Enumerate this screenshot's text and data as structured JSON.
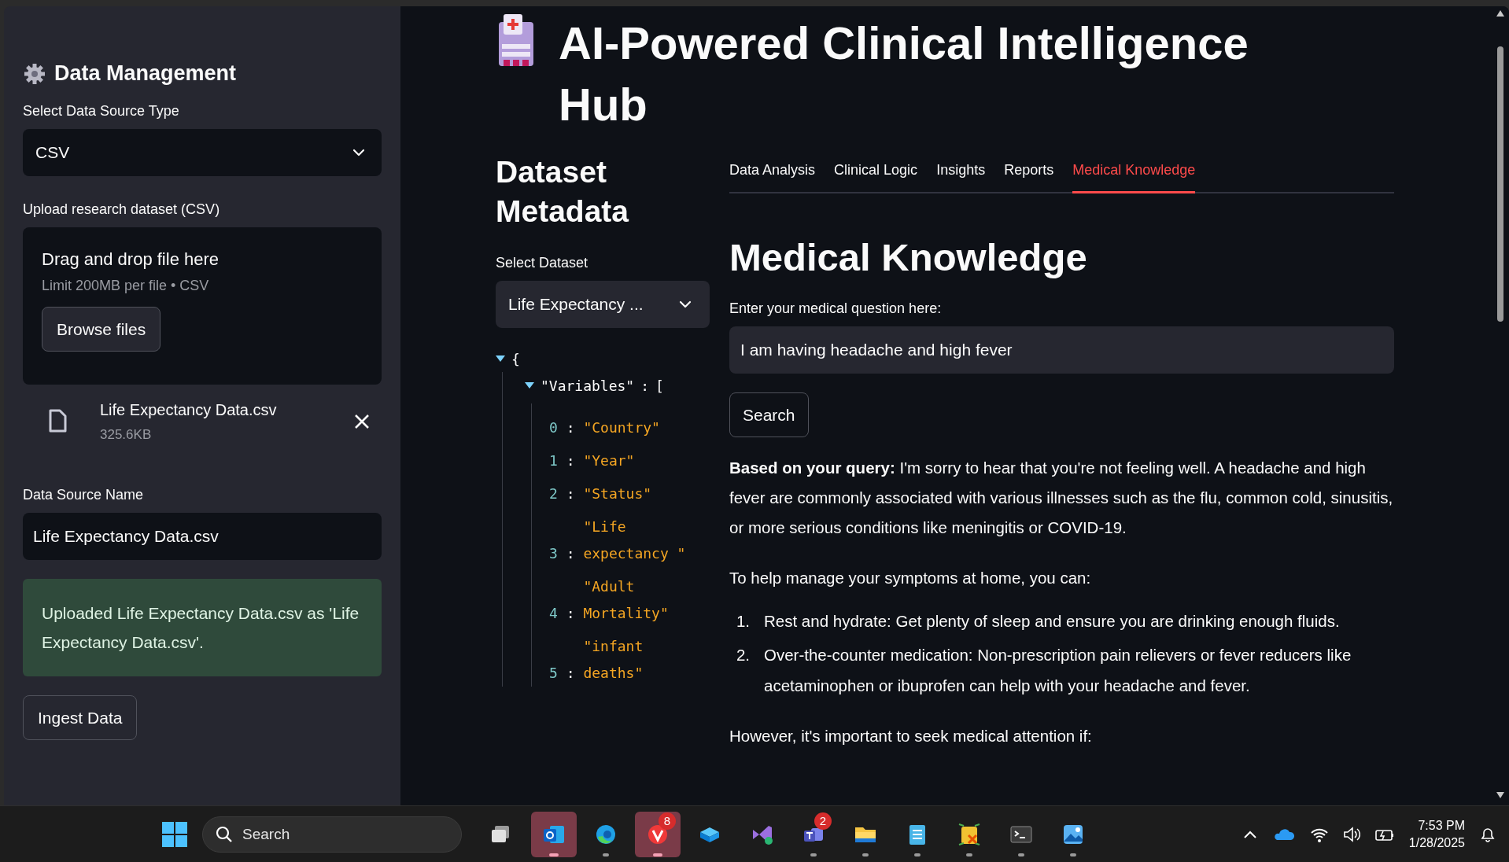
{
  "sidebar": {
    "title": "Data Management",
    "source_type": {
      "label": "Select Data Source Type",
      "value": "CSV"
    },
    "upload": {
      "label": "Upload research dataset (CSV)",
      "drop_text": "Drag and drop file here",
      "limit": "Limit 200MB per file • CSV",
      "browse_button": "Browse files"
    },
    "uploaded_file": {
      "name": "Life Expectancy Data.csv",
      "size": "325.6KB"
    },
    "source_name": {
      "label": "Data Source Name",
      "value": "Life Expectancy Data.csv"
    },
    "success_message": "Uploaded Life Expectancy Data.csv as 'Life Expectancy Data.csv'.",
    "ingest_button": "Ingest Data"
  },
  "main": {
    "title": "AI-Powered Clinical Intelligence Hub",
    "metadata": {
      "heading": "Dataset Metadata",
      "select_label": "Select Dataset",
      "select_value": "Life Expectancy ...",
      "tree": {
        "open_brace": "{",
        "expanded": true,
        "key": "\"Variables\"",
        "separator": ":",
        "open_bracket": "[",
        "list_expanded": true,
        "items": [
          {
            "index": "0",
            "separator": ":",
            "value": "\"Country\""
          },
          {
            "index": "1",
            "separator": ":",
            "value": "\"Year\""
          },
          {
            "index": "2",
            "separator": ":",
            "value": "\"Status\""
          },
          {
            "index": "3",
            "separator": ":",
            "value": "\"Life expectancy \""
          },
          {
            "index": "4",
            "separator": ":",
            "value": "\"Adult Mortality\""
          },
          {
            "index": "5",
            "separator": ":",
            "value": "\"infant deaths\""
          }
        ]
      }
    },
    "tabs": [
      {
        "label": "Data Analysis",
        "selected": false
      },
      {
        "label": "Clinical Logic",
        "selected": false
      },
      {
        "label": "Insights",
        "selected": false
      },
      {
        "label": "Reports",
        "selected": false
      },
      {
        "label": "Medical Knowledge",
        "selected": true
      }
    ],
    "knowledge": {
      "heading": "Medical Knowledge",
      "question_label": "Enter your medical question here:",
      "question_value": "I am having headache and high fever",
      "search_button": "Search",
      "answer_intro": "**Based on your query:** I'm sorry to hear that you're not feeling well. A headache and high fever are commonly associated with various illnesses such as the flu, common cold, sinusitis, or more serious conditions like meningitis or COVID-19.",
      "answer_lead": "To help manage your symptoms at home, you can:",
      "answer_steps": [
        {
          "number": "1.",
          "text": "Rest and hydrate: Get plenty of sleep and ensure you are drinking enough fluids."
        },
        {
          "number": "2.",
          "text": "Over-the-counter medication: Non-prescription pain relievers or fever reducers like acetaminophen or ibuprofen can help with your headache and fever."
        }
      ],
      "answer_warning": "However, it's important to seek medical attention if:"
    }
  },
  "taskbar": {
    "search_placeholder": "Search",
    "apps": [
      {
        "kind": "taskview",
        "active": false,
        "running": false
      },
      {
        "kind": "mail",
        "active": true,
        "running": true
      },
      {
        "kind": "browser",
        "active": false,
        "running": true
      },
      {
        "kind": "shield",
        "active": true,
        "running": true,
        "badge": "8"
      },
      {
        "kind": "cube",
        "active": false,
        "running": false
      },
      {
        "kind": "studio",
        "active": false,
        "running": false
      },
      {
        "kind": "teams",
        "active": false,
        "running": true,
        "badge": "2"
      },
      {
        "kind": "folder",
        "active": false,
        "running": true
      },
      {
        "kind": "notepad",
        "active": false,
        "running": true
      },
      {
        "kind": "database",
        "active": false,
        "running": true
      },
      {
        "kind": "terminal",
        "active": false,
        "running": true
      },
      {
        "kind": "photos",
        "active": false,
        "running": true
      }
    ],
    "time": "7:53 PM",
    "date": "1/28/2025"
  }
}
